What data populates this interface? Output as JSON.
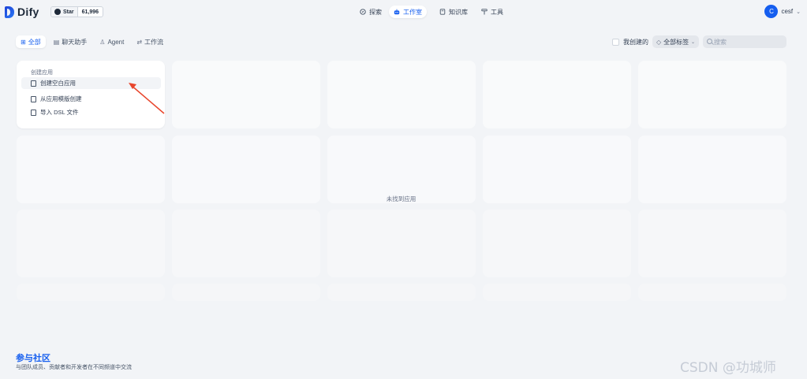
{
  "brand": {
    "name": "Dify"
  },
  "github": {
    "star_label": "Star",
    "count": "61,996"
  },
  "nav": [
    {
      "label": "探索",
      "icon": "compass-icon"
    },
    {
      "label": "工作室",
      "icon": "robot-icon",
      "active": true
    },
    {
      "label": "知识库",
      "icon": "book-icon"
    },
    {
      "label": "工具",
      "icon": "hammer-icon"
    }
  ],
  "user": {
    "initial": "C",
    "name": "cesf"
  },
  "tabs": [
    {
      "label": "全部",
      "icon": "grid-icon",
      "active": true
    },
    {
      "label": "聊天助手",
      "icon": "chat-icon"
    },
    {
      "label": "Agent",
      "icon": "agent-icon"
    },
    {
      "label": "工作流",
      "icon": "workflow-icon"
    }
  ],
  "filters": {
    "mine_label": "我创建的",
    "mine_checked": false,
    "tag_label": "全部标签",
    "search_placeholder": "搜索"
  },
  "create": {
    "title": "创建应用",
    "items": [
      {
        "label": "创建空白应用",
        "icon": "blank-file-icon"
      },
      {
        "label": "从应用模版创建",
        "icon": "template-icon"
      },
      {
        "label": "导入 DSL 文件",
        "icon": "import-icon"
      }
    ]
  },
  "empty_text": "未找到应用",
  "footer": {
    "title": "参与社区",
    "subtitle": "与团队成员、贡献者和开发者在不同频道中交流"
  },
  "watermark": "CSDN @功城师",
  "colors": {
    "accent": "#155eef",
    "arrow": "#e8452c",
    "background": "#f2f4f7"
  }
}
